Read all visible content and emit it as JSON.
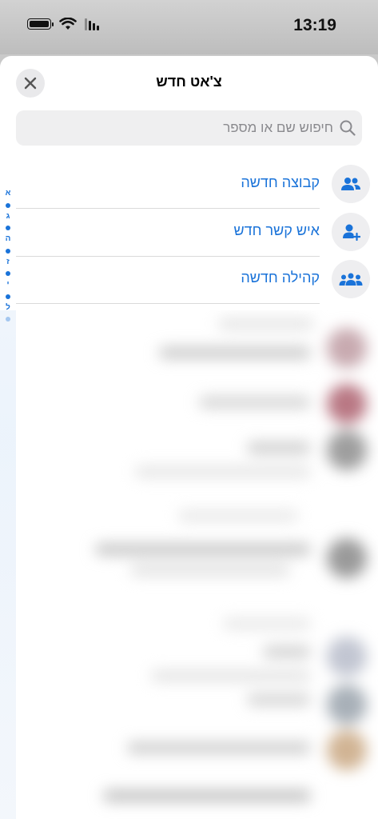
{
  "status_bar": {
    "time": "13:19"
  },
  "sheet": {
    "title": "צ'אט חדש",
    "search_placeholder": "חיפוש שם או מספר"
  },
  "actions": [
    {
      "label": "קבוצה חדשה",
      "icon": "group-icon"
    },
    {
      "label": "איש קשר חדש",
      "icon": "add-contact-icon"
    },
    {
      "label": "קהילה חדשה",
      "icon": "community-icon"
    }
  ],
  "index_letters": [
    "א",
    "ג",
    "ה",
    "ז",
    "י",
    "ל"
  ],
  "colors": {
    "accent": "#1a73d9",
    "sheet_bg": "#ffffff",
    "field_bg": "#efeff0"
  }
}
